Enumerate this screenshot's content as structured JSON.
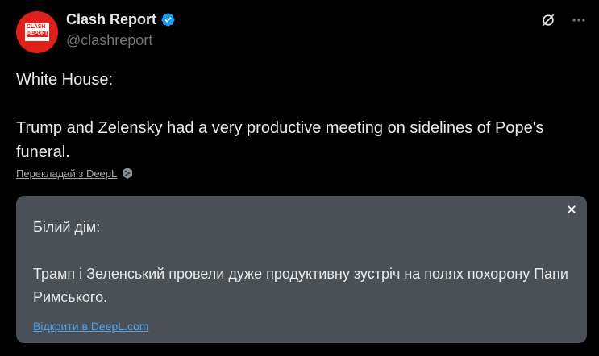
{
  "author": {
    "display_name": "Clash Report",
    "handle": "@clashreport",
    "avatar_line1": "CLASH",
    "avatar_line2": "REPORT",
    "verified_icon": "verified-badge-icon",
    "verified_color": "#1d9bf0",
    "avatar_color": "#e0201b"
  },
  "actions": {
    "grok_icon": "grok-icon",
    "more_icon": "more-icon"
  },
  "tweet": {
    "text": "White House:\n\nTrump and Zelensky had a very productive meeting on sidelines of Pope's funeral."
  },
  "translate": {
    "link_label": "Перекладай з DeepL",
    "icon": "deepl-icon"
  },
  "translation": {
    "text": "Білий дім:\n\nТрамп і Зеленський провели дуже продуктивну зустріч на полях похорону Папи Римського.",
    "open_link_label": "Відкрити в DeepL.com",
    "close_icon": "close-icon",
    "box_color": "#4a5056",
    "link_color": "#4ea3ee"
  }
}
